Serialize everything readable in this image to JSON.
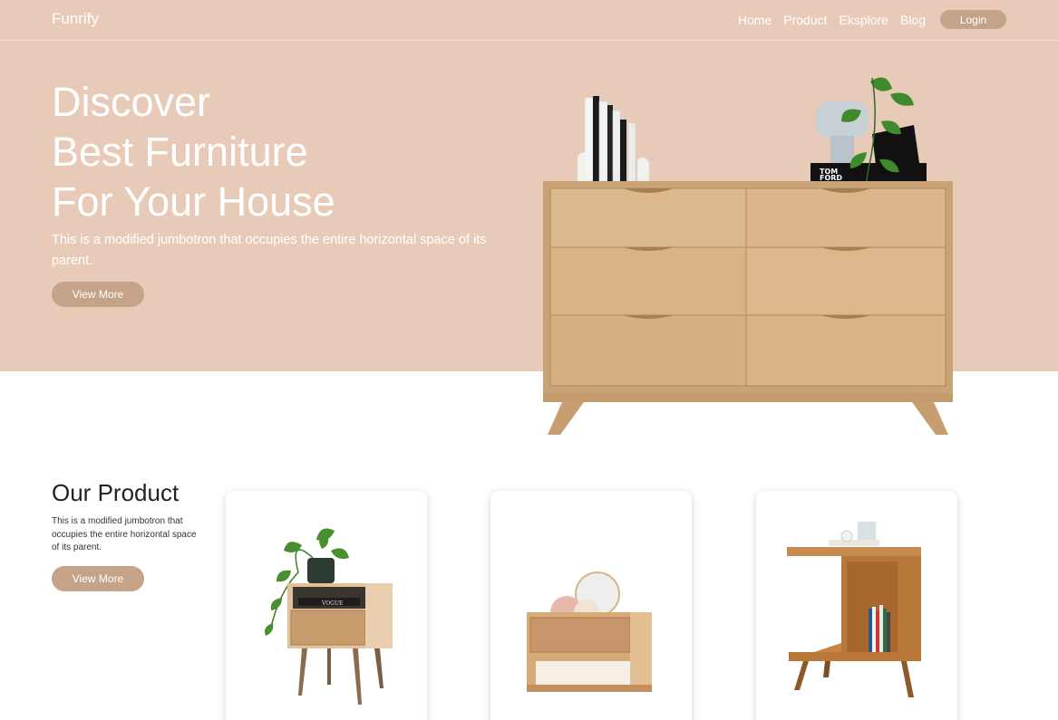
{
  "navbar": {
    "brand": "Funrify",
    "links": [
      "Home",
      "Product",
      "Eksplore",
      "Blog"
    ],
    "login_label": "Login"
  },
  "hero": {
    "title_lines": [
      "Discover",
      "Best Furniture",
      "For Your House"
    ],
    "description": "This is a modified jumbotron that occupies the entire horizontal space of its parent.",
    "button_label": "View More",
    "book_texts": [
      "TOM",
      "FORD"
    ]
  },
  "products": {
    "title": "Our Product",
    "description": "This is a modified jumbotron that occupies the entire horizontal space of its parent.",
    "button_label": "View More",
    "cards": [
      {
        "image": "nightstand-with-plant",
        "book_text": "VOGUE"
      },
      {
        "image": "floating-drawer-with-mirrors"
      },
      {
        "image": "side-table-with-books"
      }
    ]
  },
  "colors": {
    "hero_background": "#e8cab9",
    "button_background": "#c4a389",
    "wood": "#d9b487",
    "text_dark": "#222222"
  }
}
